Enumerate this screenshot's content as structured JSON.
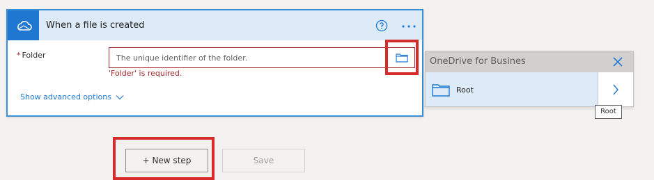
{
  "trigger_card": {
    "title": "When a file is created",
    "service_icon": "onedrive-cloud-icon",
    "help_icon": "help-circle-icon",
    "more_icon": "more-ellipsis-icon",
    "accent_color": "#1f77d2",
    "header_color": "#dcebf7",
    "folder_field": {
      "required_marker": "*",
      "label": "Folder",
      "placeholder": "The unique identifier of the folder.",
      "value": "",
      "picker_icon": "folder-icon",
      "error": "'Folder' is required."
    },
    "advanced_options_label": "Show advanced options",
    "advanced_options_icon": "chevron-down-icon"
  },
  "folder_picker_panel": {
    "title": "OneDrive for Busines",
    "close_icon": "close-icon",
    "items": [
      {
        "label": "Root",
        "icon": "folder-icon",
        "nav_icon": "chevron-right-icon"
      }
    ],
    "tooltip": "Root"
  },
  "footer": {
    "new_step_label": "+ New step",
    "save_label": "Save"
  },
  "colors": {
    "error": "#a4262c",
    "highlight": "#d52b2b",
    "link": "#1f77d2"
  }
}
